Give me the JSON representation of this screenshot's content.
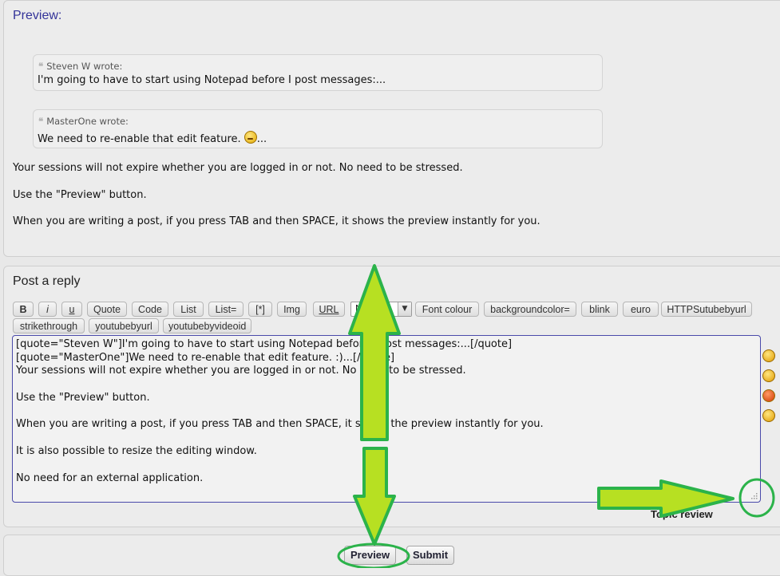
{
  "preview": {
    "heading": "Preview:",
    "quotes": [
      {
        "author": "Steven W wrote:",
        "text": "I'm going to have to start using Notepad before I post messages:..."
      },
      {
        "author": "MasterOne wrote:",
        "text_before": "We need to re-enable that edit feature. ",
        "text_after": "..."
      }
    ],
    "paragraphs": [
      "Your sessions will not expire whether you are logged in or not. No need to be stressed.",
      "Use the \"Preview\" button.",
      "When you are writing a post, if you press TAB and then SPACE, it shows the preview instantly for you."
    ]
  },
  "reply": {
    "heading": "Post a reply",
    "toolbar_row1": [
      "B",
      "i",
      "u",
      "Quote",
      "Code",
      "List",
      "List=",
      "[*]",
      "Img",
      "URL"
    ],
    "font_size_value": "N",
    "toolbar_row1_right": [
      "Font colour",
      "backgroundcolor=",
      "blink",
      "euro",
      "HTTPSutubebyurl"
    ],
    "toolbar_row2": [
      "strikethrough",
      "youtubebyurl",
      "youtubebyvideoid"
    ],
    "textarea_lines": [
      "[quote=\"Steven W\"]I'm going to have to start using Notepad before I post messages:...[/quote]",
      "[quote=\"MasterOne\"]We need to re-enable that edit feature. :)...[/quote]",
      "Your sessions will not expire whether you are logged in or not. No need to be stressed.",
      "",
      "Use the \"Preview\" button.",
      "",
      "When you are writing a post, if you press TAB and then SPACE, it shows the preview instantly for you.",
      "",
      "It is also possible to resize the editing window.",
      "",
      "No need for an external application."
    ],
    "topic_review": "Topic review"
  },
  "form_buttons": {
    "preview": "Preview",
    "submit": "Submit"
  },
  "colors": {
    "accent": "#333399",
    "annotation_arrow": "#b7e022",
    "annotation_outline": "#2bb34a"
  }
}
